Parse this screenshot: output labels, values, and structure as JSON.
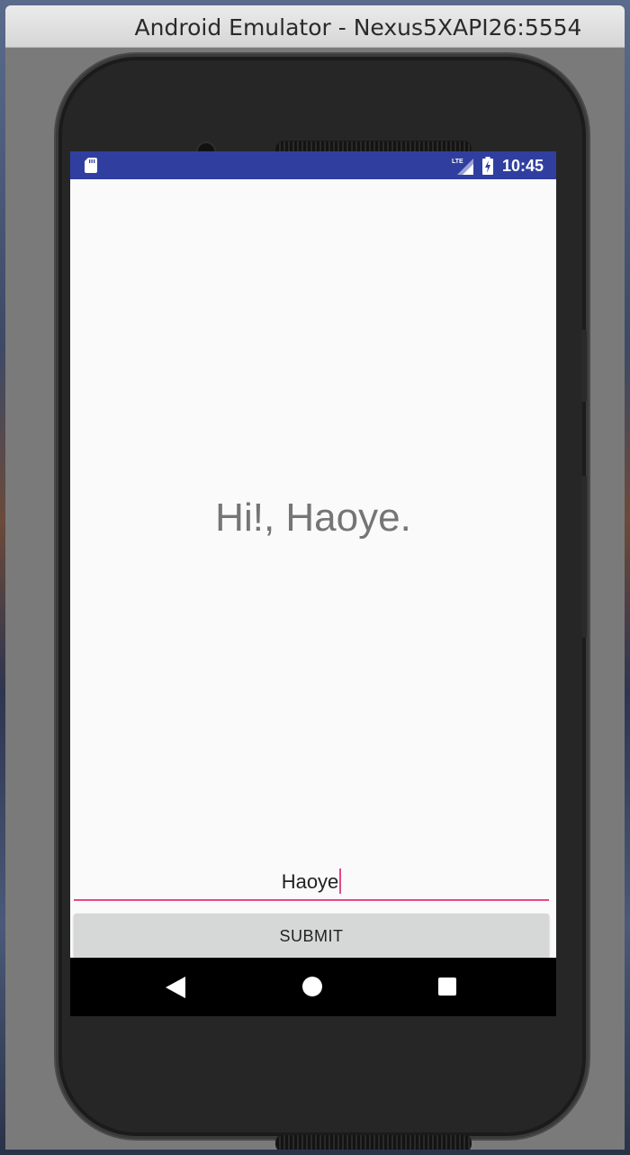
{
  "window": {
    "title": "Android Emulator - Nexus5XAPI26:5554"
  },
  "statusbar": {
    "time": "10:45",
    "network_icon": "lte-signal-icon",
    "network_label": "LTE",
    "battery_icon": "battery-charging-icon",
    "storage_icon": "sd-card-icon",
    "color": "#303f9f"
  },
  "main": {
    "greeting": "Hi!, Haoye.",
    "name_input_value": "Haoye",
    "submit_label": "SUBMIT",
    "accent_color": "#e6478a"
  },
  "navbar": {
    "back_icon": "back-triangle-icon",
    "home_icon": "home-circle-icon",
    "recents_icon": "recents-square-icon"
  }
}
